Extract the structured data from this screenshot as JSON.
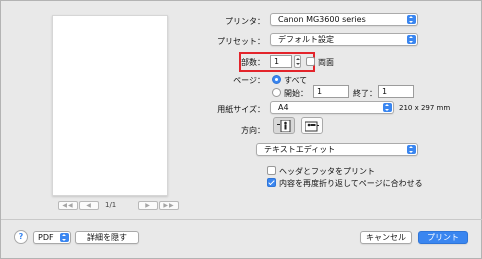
{
  "preview": {
    "page_indicator": "1/1",
    "first": "◀◀",
    "prev": "◀",
    "next": "▶",
    "last": "▶▶"
  },
  "printer": {
    "label": "プリンタ：",
    "value": "Canon MG3600 series"
  },
  "preset": {
    "label": "プリセット：",
    "value": "デフォルト設定"
  },
  "copies": {
    "label": "部数：",
    "value": "1",
    "duplex_label": "両面",
    "duplex_checked": false
  },
  "pages": {
    "label": "ページ：",
    "all_label": "すべて",
    "from_label": "開始：",
    "from_value": "1",
    "to_label": "終了：",
    "to_value": "1",
    "selected": "all"
  },
  "paper": {
    "label": "用紙サイズ：",
    "value": "A4",
    "dimensions": "210 x 297 mm"
  },
  "orientation": {
    "label": "方向：",
    "selected": "portrait"
  },
  "app_menu": {
    "value": "テキストエディット"
  },
  "options": {
    "header_footer_label": "ヘッダとフッタをプリント",
    "header_footer_checked": false,
    "rewrap_label": "内容を再度折り返してページに合わせる",
    "rewrap_checked": true
  },
  "footer": {
    "help": "?",
    "pdf_label": "PDF",
    "hide_details_label": "詳細を隠す",
    "cancel_label": "キャンセル",
    "print_label": "プリント"
  },
  "colors": {
    "accent": "#3a86f0",
    "highlight": "#e3242b",
    "background": "#e9e9e9"
  }
}
